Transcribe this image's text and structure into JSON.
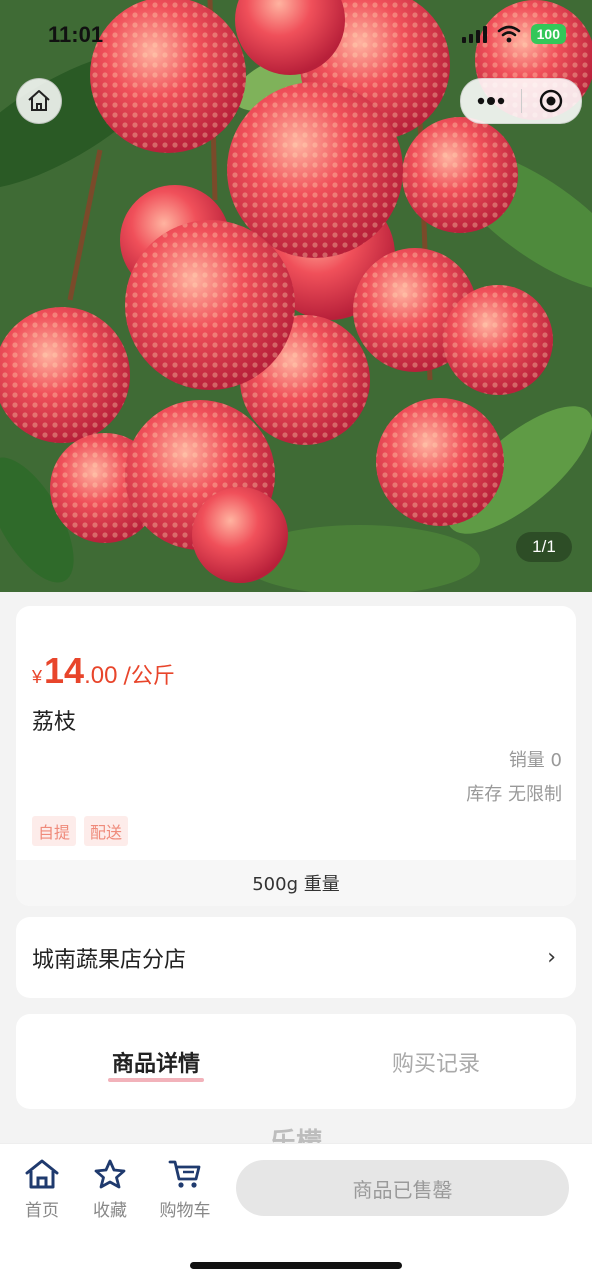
{
  "status_bar": {
    "time": "11:01",
    "battery": "100"
  },
  "gallery": {
    "counter": "1/1"
  },
  "product": {
    "currency": "¥",
    "price_int": "14",
    "price_dec": ".00",
    "price_unit": "/公斤",
    "name": "荔枝",
    "sales": "销量 0",
    "stock": "库存 无限制",
    "tags": [
      "自提",
      "配送"
    ],
    "spec": "500g 重量"
  },
  "store": {
    "name": "城南蔬果店分店",
    "arrow": "›"
  },
  "tabs": [
    {
      "label": "商品详情",
      "active": true
    },
    {
      "label": "购买记录",
      "active": false
    }
  ],
  "peek_text": "乐檬",
  "bottom_nav": {
    "home": "首页",
    "favorite": "收藏",
    "cart": "购物车",
    "sold_out": "商品已售罄"
  },
  "colors": {
    "price": "#e8452b",
    "tag_bg": "#fdecea",
    "tag_text": "#ef8a7a",
    "nav_icon": "#1f3a6e",
    "battery": "#34c759"
  }
}
